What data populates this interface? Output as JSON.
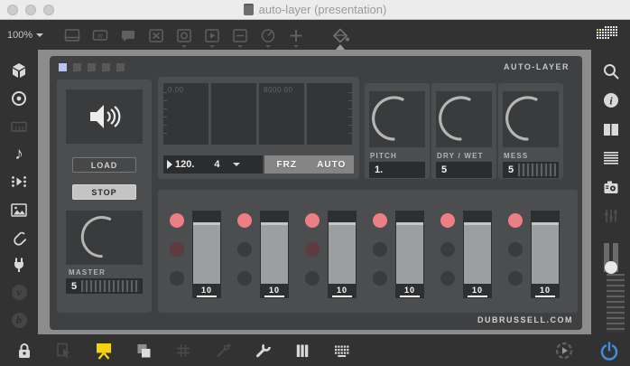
{
  "window": {
    "title": "auto-layer (presentation)"
  },
  "top_toolbar": {
    "zoom_label": "100%",
    "icons": [
      "object-box-icon",
      "message-box-icon",
      "comment-icon",
      "toggle-icon",
      "button-icon",
      "playbar-icon",
      "number-box-icon",
      "dial-icon",
      "add-object-icon",
      "paint-bucket-icon",
      "object-palette-grid-icon"
    ]
  },
  "left_sidebar": {
    "icons": [
      "package-icon",
      "record-icon",
      "keyboard-shortcuts-icon",
      "audio-icon",
      "playlist-icon",
      "image-icon",
      "attachments-icon",
      "plug-icon",
      "vizzie-icon",
      "beap-icon"
    ]
  },
  "right_sidebar": {
    "icons": [
      "search-icon",
      "info-icon",
      "inspector-panes-icon",
      "list-icon",
      "snapshot-camera-icon",
      "mixer-icon",
      "zoom-slider"
    ]
  },
  "bottom_toolbar": {
    "icons": [
      "lock-icon",
      "select-icon",
      "presentation-mode-icon",
      "layers-icon",
      "grid-icon",
      "probe-icon",
      "wrench-icon",
      "faders-icon",
      "keyboard-icon",
      "run-icon",
      "audio-power-icon"
    ]
  },
  "patch": {
    "title": "AUTO-LAYER",
    "footer": "DUBRUSSELL.COM",
    "preview_squares": {
      "count": 5,
      "selected_index": 0
    },
    "left_module": {
      "speaker_icon": "speaker-icon",
      "load_label": "LOAD",
      "stop_label": "STOP",
      "master_label": "MASTER",
      "master_value": "5"
    },
    "display_module": {
      "label_left": "0.00",
      "label_mid": "8000.00",
      "segments": 4
    },
    "transport": {
      "tempo": "120.",
      "beats": "4",
      "frz_label": "FRZ",
      "auto_label": "AUTO"
    },
    "knobs": [
      {
        "label": "PITCH",
        "value": "1.",
        "ridged": false
      },
      {
        "label": "DRY / WET",
        "value": "5",
        "ridged": false
      },
      {
        "label": "MESS",
        "value": "5",
        "ridged": true
      }
    ],
    "mixer": {
      "channels": [
        {
          "value": "10",
          "dots": [
            "active",
            "muted-red",
            "muted"
          ]
        },
        {
          "value": "10",
          "dots": [
            "active",
            "muted",
            "muted"
          ]
        },
        {
          "value": "10",
          "dots": [
            "active",
            "muted-red",
            "muted"
          ]
        },
        {
          "value": "10",
          "dots": [
            "active",
            "muted",
            "muted"
          ]
        },
        {
          "value": "10",
          "dots": [
            "active",
            "muted",
            "muted"
          ]
        },
        {
          "value": "10",
          "dots": [
            "active",
            "muted",
            "muted"
          ]
        }
      ]
    }
  },
  "colors": {
    "accent_pink": "#ee7e85",
    "selected_square_blue": "#b9c3ee",
    "presentation_yellow": "#f2d211",
    "power_blue": "#3f8fe0",
    "panel_dark": "#3f4041",
    "module_gray": "#4b4d4e"
  }
}
